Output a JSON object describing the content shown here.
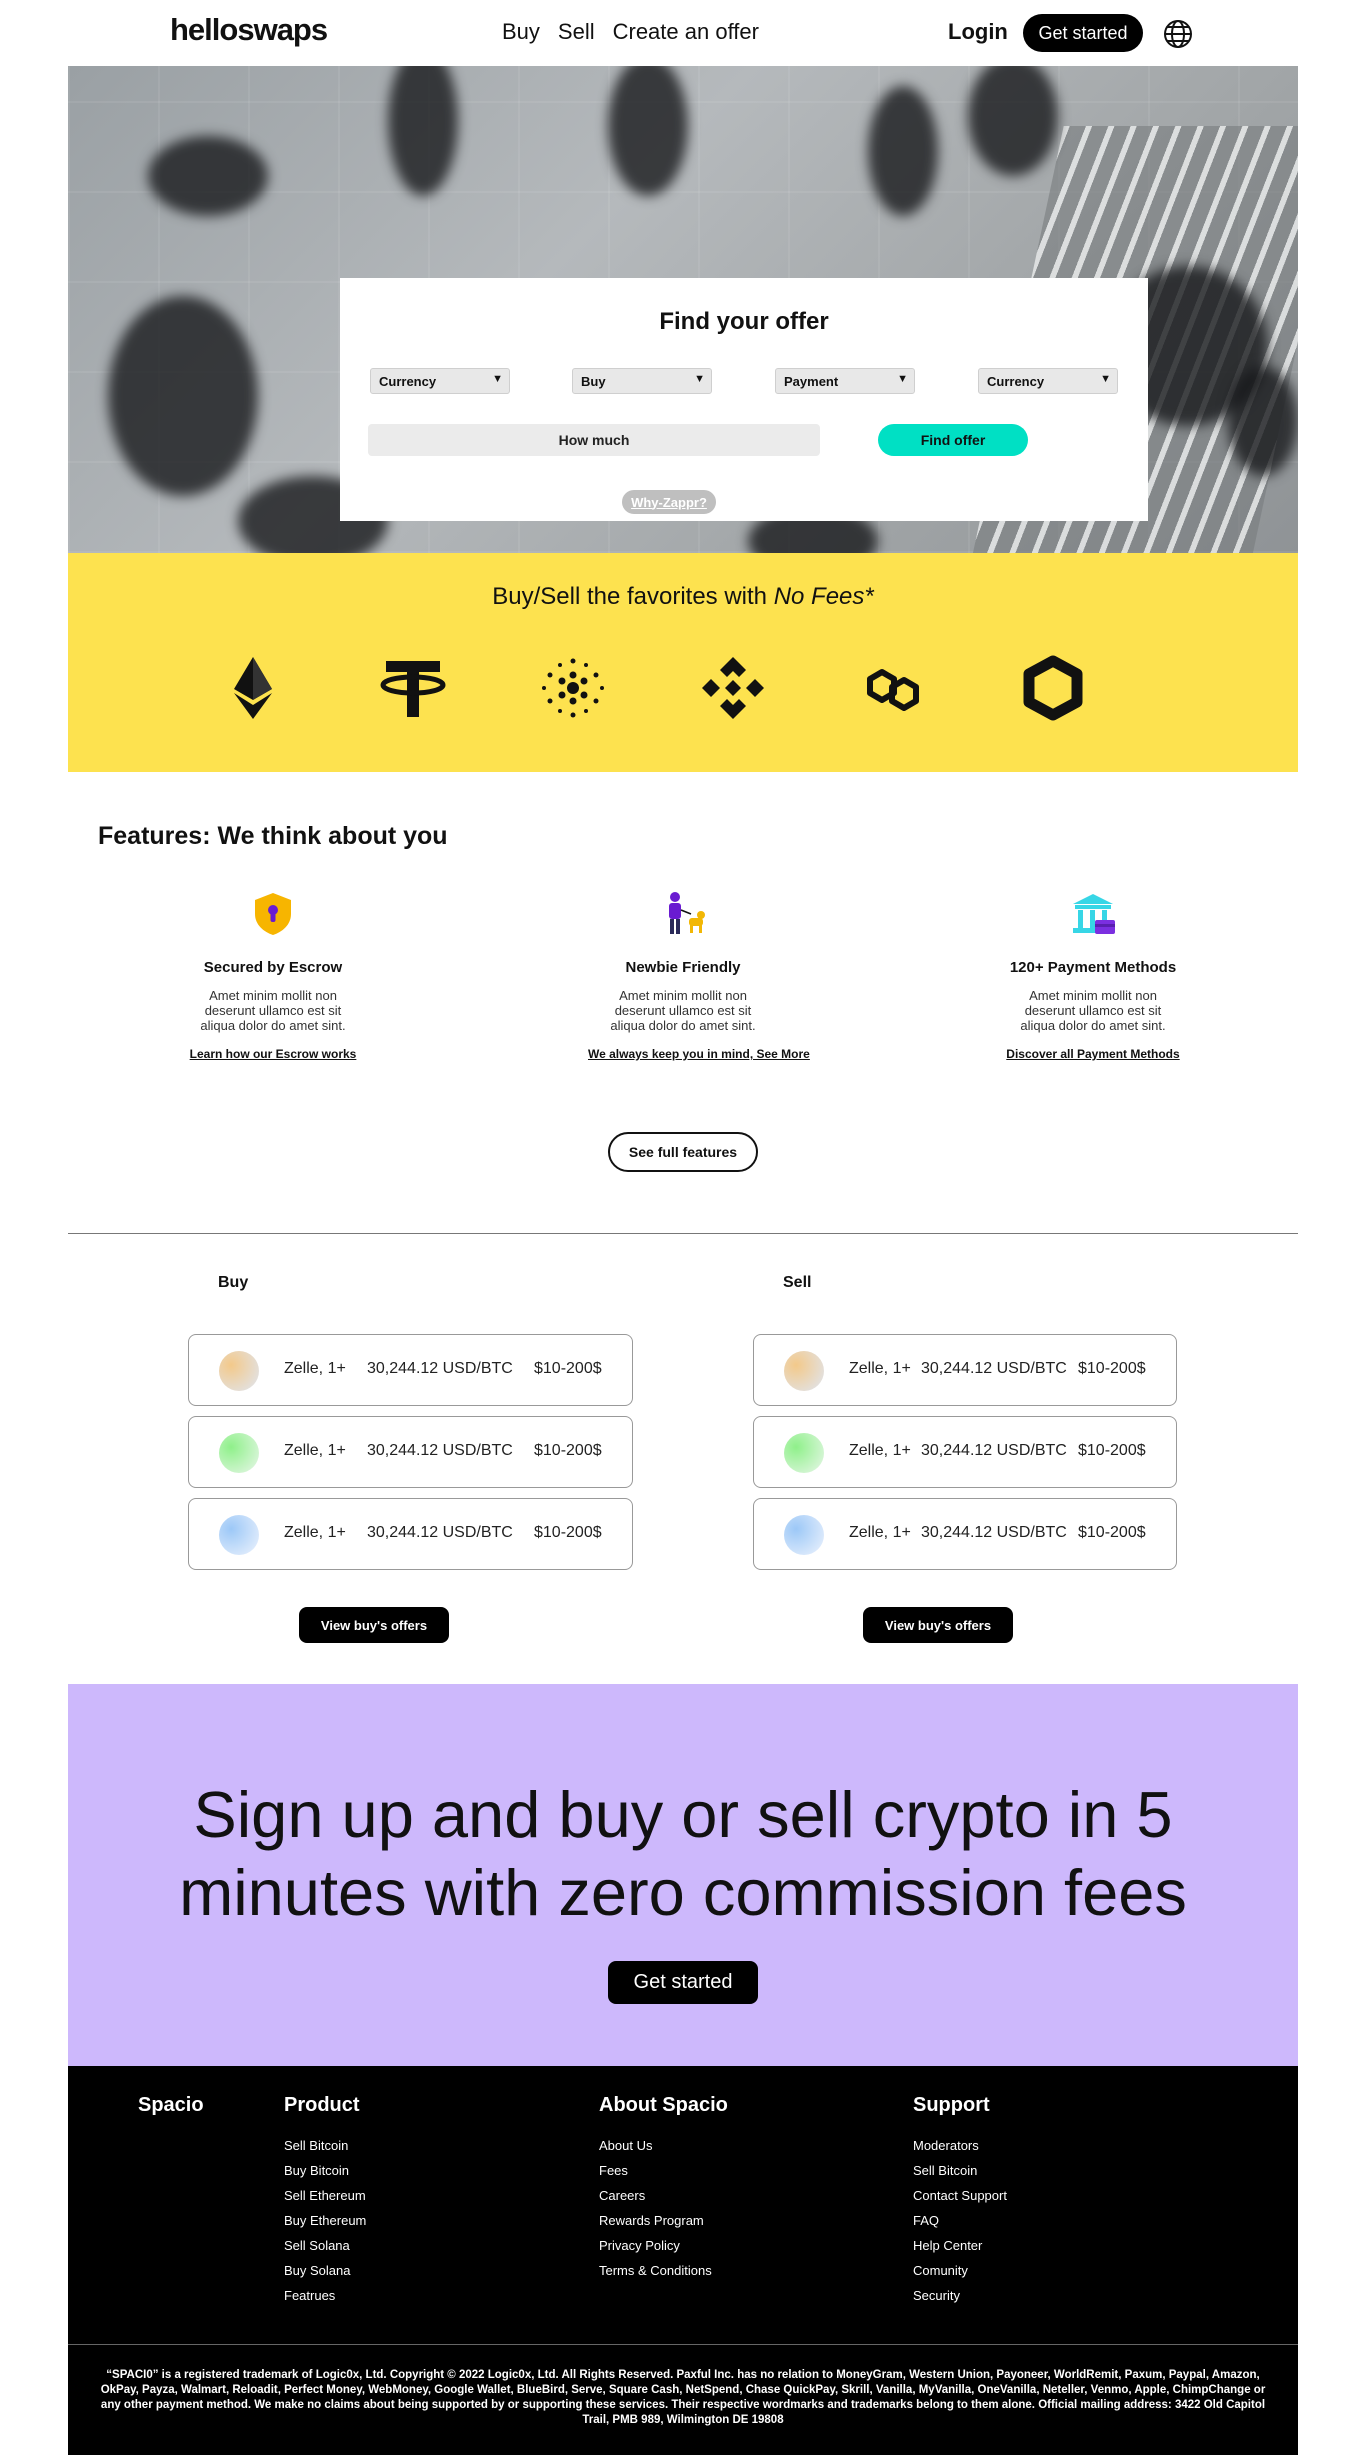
{
  "header": {
    "logo": "helloswaps",
    "nav": [
      "Buy",
      "Sell",
      "Create an offer"
    ],
    "login": "Login",
    "get_started": "Get started"
  },
  "search": {
    "title": "Find your offer",
    "selects": [
      "Currency",
      "Buy",
      "Payment",
      "Currency"
    ],
    "how_much_placeholder": "How much",
    "find_button": "Find offer",
    "why_link": "Why-Zappr?"
  },
  "favorites": {
    "title_plain": "Buy/Sell the favorites with ",
    "title_emph": "No Fees*",
    "coins": [
      "ethereum-icon",
      "tether-icon",
      "cardano-icon",
      "binance-icon",
      "polygon-icon",
      "hexagon-token-icon"
    ]
  },
  "features": {
    "title": "Features: We think about you",
    "items": [
      {
        "icon": "escrow-shield-icon",
        "name": "Secured by Escrow",
        "desc": "Amet minim mollit non deserunt ullamco est sit aliqua dolor do amet sint.",
        "link": "Learn how our Escrow works"
      },
      {
        "icon": "newbie-person-icon",
        "name": "Newbie Friendly",
        "desc": "Amet minim mollit non deserunt ullamco est sit aliqua dolor do amet sint.",
        "link": "We always keep you in mind, See More"
      },
      {
        "icon": "bank-icon",
        "name": "120+ Payment Methods",
        "desc": "Amet minim mollit non deserunt ullamco est sit aliqua dolor do amet sint.",
        "link": "Discover all Payment Methods"
      }
    ],
    "see_full": "See full features"
  },
  "offers": {
    "buy": {
      "title": "Buy",
      "rows": [
        {
          "method": "Zelle, 1+",
          "price": "30,244.12 USD/BTC",
          "range": "$10-200$",
          "gradient": [
            "#f3c98a",
            "#dfe6f3"
          ]
        },
        {
          "method": "Zelle, 1+",
          "price": "30,244.12 USD/BTC",
          "range": "$10-200$",
          "gradient": [
            "#8ff08a",
            "#e9f7ea"
          ]
        },
        {
          "method": "Zelle, 1+",
          "price": "30,244.12 USD/BTC",
          "range": "$10-200$",
          "gradient": [
            "#9cc8f7",
            "#eef3fd"
          ]
        }
      ],
      "button": "View buy's offers"
    },
    "sell": {
      "title": "Sell",
      "rows": [
        {
          "method": "Zelle, 1+",
          "price": "30,244.12 USD/BTC",
          "range": "$10-200$",
          "gradient": [
            "#f3c98a",
            "#dfe6f3"
          ]
        },
        {
          "method": "Zelle, 1+",
          "price": "30,244.12 USD/BTC",
          "range": "$10-200$",
          "gradient": [
            "#8ff08a",
            "#e9f7ea"
          ]
        },
        {
          "method": "Zelle, 1+",
          "price": "30,244.12 USD/BTC",
          "range": "$10-200$",
          "gradient": [
            "#9cc8f7",
            "#eef3fd"
          ]
        }
      ],
      "button": "View buy's offers"
    }
  },
  "cta": {
    "line1": "Sign up and buy or sell crypto in 5",
    "line2": "minutes with zero commission fees",
    "button": "Get started"
  },
  "footer": {
    "brand": "Spacio",
    "columns": [
      {
        "title": "Product",
        "links": [
          "Sell Bitcoin",
          "Buy Bitcoin",
          "Sell Ethereum",
          "Buy Ethereum",
          "Sell Solana",
          "Buy Solana",
          "Featrues"
        ]
      },
      {
        "title": "About Spacio",
        "links": [
          "About Us",
          "Fees",
          "Careers",
          "Rewards Program",
          "Privacy Policy",
          "Terms & Conditions"
        ]
      },
      {
        "title": "Support",
        "links": [
          "Moderators",
          "Sell Bitcoin",
          "Contact Support",
          "FAQ",
          "Help Center",
          "Comunity",
          "Security"
        ]
      }
    ],
    "legal": "“SPACI0” is a registered trademark of Logic0x, Ltd. Copyright © 2022 Logic0x, Ltd. All Rights Reserved. Paxful Inc. has no relation to MoneyGram, Western Union, Payoneer, WorldRemit, Paxum, Paypal, Amazon, OkPay, Payza, Walmart, Reloadit, Perfect Money, WebMoney, Google Wallet, BlueBird, Serve, Square Cash, NetSpend, Chase QuickPay, Skrill, Vanilla, MyVanilla, OneVanilla, Neteller, Venmo, Apple, ChimpChange or any other payment method. We make no claims about being supported by or supporting these services. Their respective wordmarks and trademarks belong to them alone. Official mailing address: 3422 Old Capitol Trail, PMB 989, Wilmington DE 19808"
  },
  "colors": {
    "accent_teal": "#00e0c4",
    "yellow_band": "#fde24f",
    "cta_purple": "#cdb8fc",
    "black": "#000000"
  }
}
